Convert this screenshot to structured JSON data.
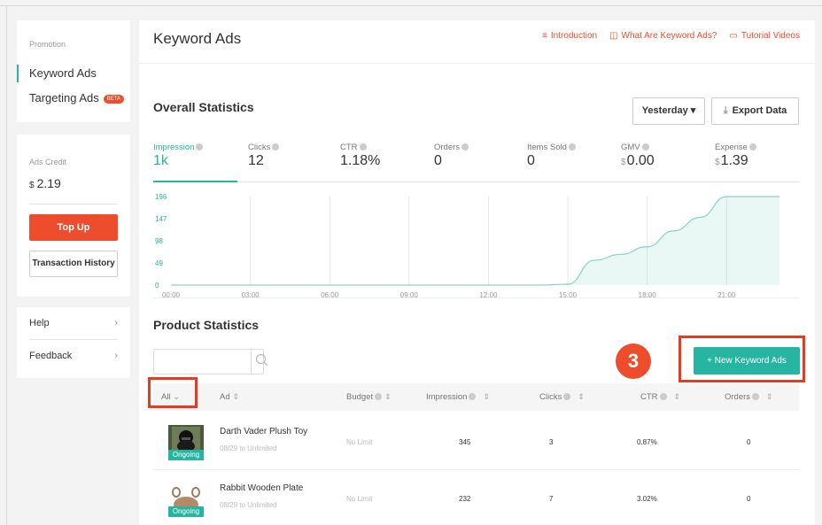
{
  "sidebar": {
    "promotion_label": "Promotion",
    "items": [
      {
        "label": "Keyword Ads"
      },
      {
        "label": "Targeting Ads",
        "badge": "BETA"
      }
    ],
    "credit": {
      "label": "Ads Credit",
      "currency": "$",
      "value": "2.19",
      "topup_label": "Top Up",
      "history_label": "Transaction History"
    },
    "help": [
      {
        "label": "Help"
      },
      {
        "label": "Feedback"
      }
    ]
  },
  "main": {
    "title": "Keyword Ads",
    "links": [
      {
        "icon": "list-icon",
        "label": "Introduction"
      },
      {
        "icon": "book-icon",
        "label": "What Are Keyword Ads?"
      },
      {
        "icon": "video-icon",
        "label": "Tutorial Videos"
      }
    ],
    "overall_title": "Overall Statistics",
    "period_label": "Yesterday",
    "export_label": "Export Data",
    "metrics": [
      {
        "label": "Impression",
        "value": "1k",
        "active": true
      },
      {
        "label": "Clicks",
        "value": "12"
      },
      {
        "label": "CTR",
        "value": "1.18%"
      },
      {
        "label": "Orders",
        "value": "0"
      },
      {
        "label": "Items Sold",
        "value": "0"
      },
      {
        "label": "GMV",
        "currency": "$",
        "value": "0.00"
      },
      {
        "label": "Expense",
        "currency": "$",
        "value": "1.39"
      }
    ],
    "product_title": "Product Statistics",
    "step_number": "3",
    "new_ads_label": "+ New Keyword Ads",
    "table": {
      "headers": {
        "filter": "All",
        "ad": "Ad",
        "budget": "Budget",
        "impression": "Impression",
        "clicks": "Clicks",
        "ctr": "CTR",
        "orders": "Orders"
      },
      "rows": [
        {
          "name": "Darth Vader Plush Toy",
          "date": "08/29 to Unlimited",
          "status": "Ongoing",
          "budget": "No Limit",
          "impression": "345",
          "clicks": "3",
          "ctr": "0.87%",
          "orders": "0"
        },
        {
          "name": "Rabbit Wooden Plate",
          "date": "08/29 to Unlimited",
          "status": "Ongoing",
          "budget": "No Limit",
          "impression": "232",
          "clicks": "7",
          "ctr": "3.02%",
          "orders": "0"
        }
      ]
    }
  },
  "chart_data": {
    "type": "area",
    "x": [
      "00:00",
      "01:00",
      "02:00",
      "03:00",
      "04:00",
      "05:00",
      "06:00",
      "07:00",
      "08:00",
      "09:00",
      "10:00",
      "11:00",
      "12:00",
      "13:00",
      "14:00",
      "15:00",
      "16:00",
      "17:00",
      "18:00",
      "19:00",
      "20:00",
      "21:00",
      "22:00",
      "23:00"
    ],
    "x_tick_labels": [
      "00:00",
      "03:00",
      "06:00",
      "09:00",
      "12:00",
      "15:00",
      "18:00",
      "21:00"
    ],
    "y_tick_labels": [
      "196",
      "147",
      "98",
      "49",
      "0"
    ],
    "series": [
      {
        "values": [
          0,
          0,
          0,
          0,
          0,
          0,
          0,
          0,
          0,
          0,
          0,
          0,
          0,
          0,
          0,
          2,
          55,
          68,
          85,
          120,
          150,
          196,
          196,
          196
        ]
      }
    ],
    "ylim": [
      0,
      196
    ],
    "color": "#26b5a0",
    "grid": true
  }
}
